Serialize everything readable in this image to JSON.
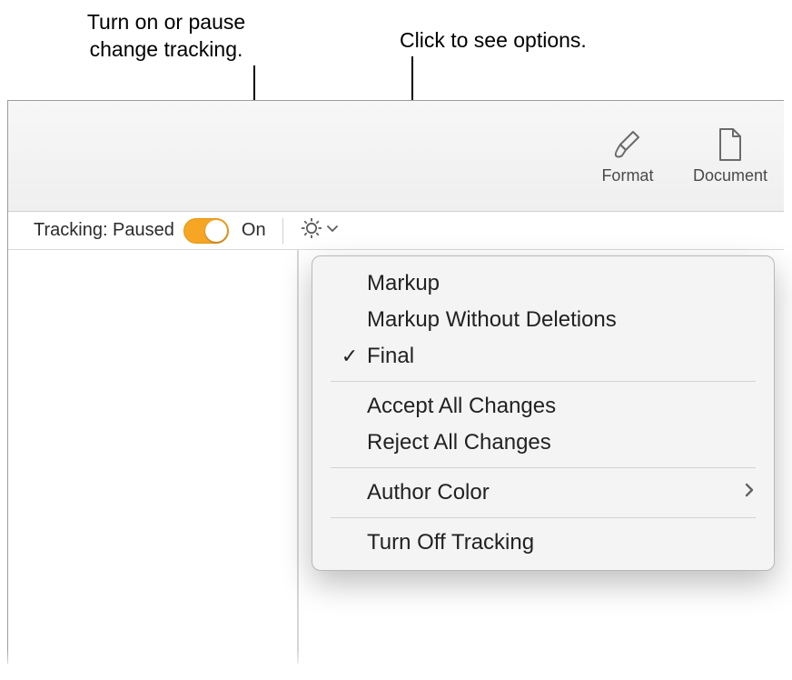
{
  "callouts": {
    "toggle_line1": "Turn on or pause",
    "toggle_line2": "change tracking.",
    "options": "Click to see options."
  },
  "toolbar": {
    "format_label": "Format",
    "document_label": "Document"
  },
  "tracking": {
    "status_label": "Tracking: Paused",
    "on_label": "On"
  },
  "menu": {
    "markup": "Markup",
    "markup_without_deletions": "Markup Without Deletions",
    "final": "Final",
    "accept_all": "Accept All Changes",
    "reject_all": "Reject All Changes",
    "author_color": "Author Color",
    "turn_off": "Turn Off Tracking",
    "selected": "final"
  },
  "colors": {
    "toggle_accent": "#f6a623"
  }
}
